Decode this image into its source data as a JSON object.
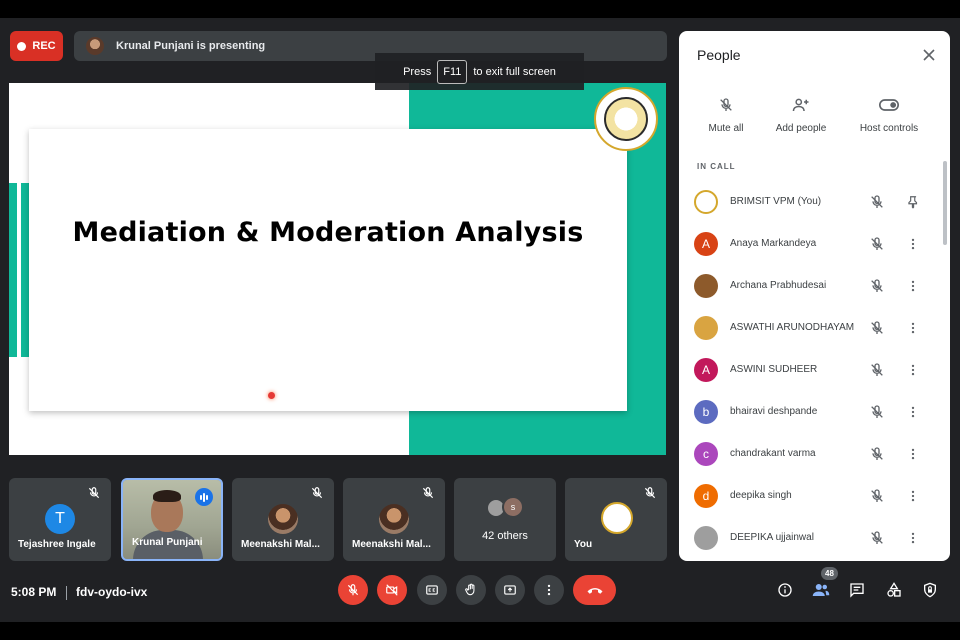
{
  "top_bar": {
    "rec_label": "REC",
    "presenting_text": "Krunal Punjani is presenting"
  },
  "fullscreen_hint": {
    "press": "Press",
    "key": "F11",
    "rest": "to exit full screen"
  },
  "slide": {
    "title": "Mediation & Moderation Analysis"
  },
  "tiles": [
    {
      "name": "Tejashree Ingale",
      "letter": "T"
    },
    {
      "name": "Krunal Punjani"
    },
    {
      "name": "Meenakshi Mal..."
    },
    {
      "name": "Meenakshi Mal..."
    },
    {
      "name": "42 others",
      "badge_letter": "s"
    },
    {
      "name": "You"
    }
  ],
  "bottom_bar": {
    "time": "5:08 PM",
    "meeting_code": "fdv-oydo-ivx",
    "people_count": "48"
  },
  "people_panel": {
    "title": "People",
    "actions": [
      "Mute all",
      "Add people",
      "Host controls"
    ],
    "section_label": "IN CALL",
    "participants": [
      {
        "name": "BRIMSIT VPM (You)",
        "avatar_color": "#ffffff",
        "letter": ""
      },
      {
        "name": "Anaya Markandeya",
        "avatar_color": "#d84315",
        "letter": "A"
      },
      {
        "name": "Archana Prabhudesai",
        "avatar_color": "#8d5a2b",
        "letter": ""
      },
      {
        "name": "ASWATHI ARUNODHAYAM",
        "avatar_color": "#d9a441",
        "letter": ""
      },
      {
        "name": "ASWINI SUDHEER",
        "avatar_color": "#c2185b",
        "letter": "A"
      },
      {
        "name": "bhairavi deshpande",
        "avatar_color": "#5c6bc0",
        "letter": "b"
      },
      {
        "name": "chandrakant varma",
        "avatar_color": "#ab47bc",
        "letter": "c"
      },
      {
        "name": "deepika singh",
        "avatar_color": "#ef6c00",
        "letter": "d"
      },
      {
        "name": "DEEPIKA ujjainwal",
        "avatar_color": "#9e9e9e",
        "letter": ""
      }
    ]
  }
}
